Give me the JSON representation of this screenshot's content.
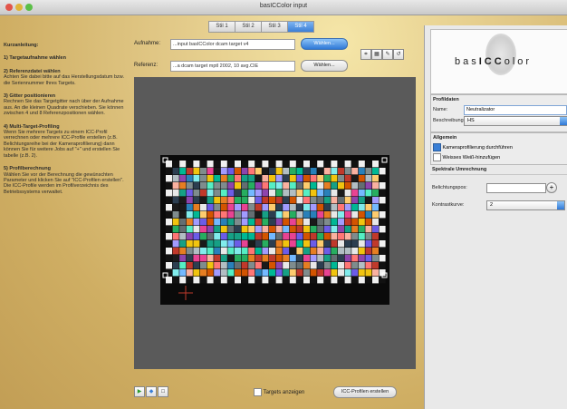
{
  "window": {
    "title": "basICColor input"
  },
  "tabs": [
    {
      "label": "Stil 1",
      "active": false
    },
    {
      "label": "Stil 2",
      "active": false
    },
    {
      "label": "Stil 3",
      "active": false
    },
    {
      "label": "Stil 4",
      "active": true
    }
  ],
  "instructions": {
    "heading": "Kurzanleitung:",
    "steps": [
      {
        "title": "1) Targetaufnahme wählen",
        "body": ""
      },
      {
        "title": "2) Referenzdatei wählen",
        "body": "Achten Sie dabei bitte auf das Herstellungsdatum bzw. die Seriennummer Ihres Targets."
      },
      {
        "title": "3) Gitter positionieren",
        "body": "Rechnen Sie das Targetgitter nach über der Aufnahme aus. An die kleinen Quadrate verschieben. Sie können zwischen 4 und 8 Referenzpositionen wählen."
      },
      {
        "title": "4) Multi-Target-Profiling",
        "body": "Wenn Sie mehrere Targets zu einem ICC-Profil verrechnen oder mehrere ICC-Profile erstellen (z.B. Belichtungsreihe bei der Kameraprofilierung) dann können Sie für weitere Jobs auf \"+\" und erstellen Sie tabelle (z.B. 2)."
      },
      {
        "title": "5) Profilberechnung",
        "body": "Wählen Sie vor der Berechnung die gewünschten Parameter und klicken Sie auf \"ICC-Profilen erstellen\". Die ICC-Profile werden im Profilverzeichnis des Betriebssystems verwaltet."
      }
    ]
  },
  "main": {
    "aufnahme_label": "Aufnahme:",
    "aufnahme_value": "...input basICColor dcam target v4",
    "aufnahme_button": "Wählen...",
    "referenz_label": "Referenz:",
    "referenz_value": "...a dcam target mptl 2002, 10 avg.CIE",
    "referenz_button": "Wählen...",
    "tools": [
      "grid-tool",
      "crop-tool",
      "pick-tool",
      "rotate-tool"
    ],
    "target_show_label": "Targets anzeigen",
    "create_button": "ICC-Profilen erstellen",
    "bottom_icons": [
      "add-target-icon",
      "duplicate-target-icon",
      "delete-target-icon"
    ]
  },
  "right": {
    "logo": {
      "text_pre": "bas",
      "text_mid": "ICC",
      "text_post": "olor"
    },
    "profil_header": "Profildaten",
    "name_label": "Name:",
    "name_value": "Neutralizator",
    "beschreibung_label": "Beschreibung:",
    "beschreibung_value": "HS",
    "allgemein_header": "Allgemein",
    "cb1_label": "Kameraprofilierung durchführen",
    "cb2_label": "Weisses Weiß-hinzufügen",
    "weitere_header": "Spektrale Umrechnung",
    "belichtung_label": "Belichtungspos:",
    "belichtung_value": "",
    "kontrast_label": "Kontrastkurve:",
    "kontrast_value": "2"
  },
  "colors": {
    "accent": "#3a7fd6",
    "image_bg": "#5a5a5a",
    "target_bg": "#0a0a0a"
  }
}
